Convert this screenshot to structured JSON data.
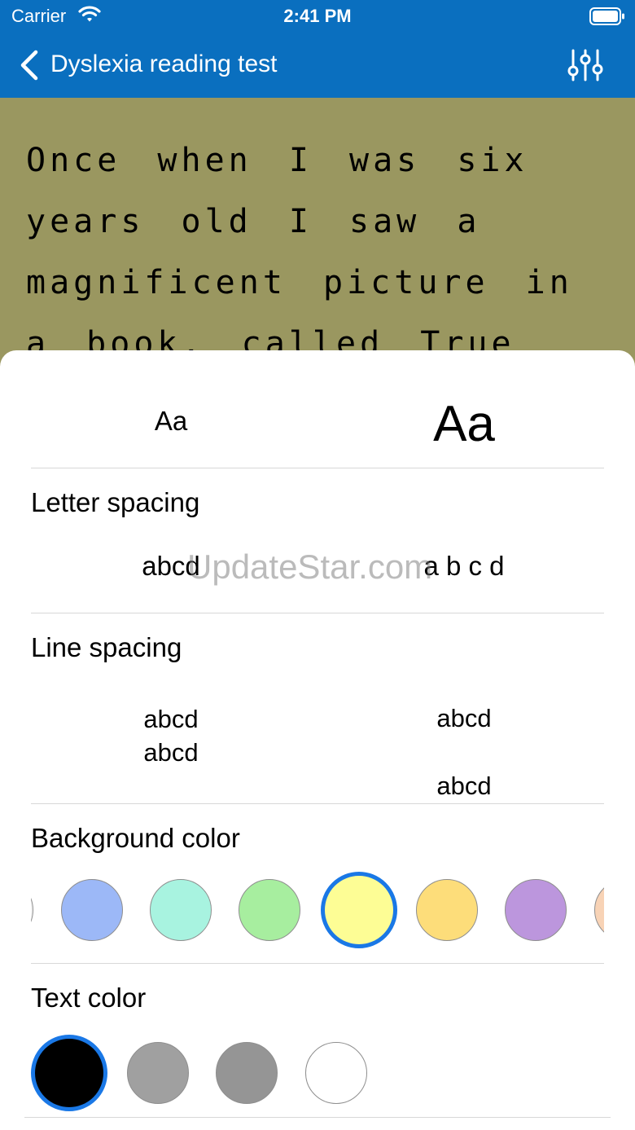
{
  "status_bar": {
    "carrier": "Carrier",
    "time": "2:41 PM"
  },
  "nav": {
    "title": "Dyslexia reading test"
  },
  "reading_text": "Once when I was six years old I saw a magnificent picture in a book, called True Stories from Nature,",
  "font_size": {
    "small_label": "Aa",
    "large_label": "Aa"
  },
  "letter_spacing": {
    "title": "Letter spacing",
    "narrow_label": "abcd",
    "wide_label": "a b c d"
  },
  "line_spacing": {
    "title": "Line spacing",
    "tight_line1": "abcd",
    "tight_line2": "abcd",
    "loose_line1": "abcd",
    "loose_line2": "abcd"
  },
  "background_color": {
    "title": "Background color",
    "swatches": [
      "#f2f2f2",
      "#9cb8f7",
      "#a8f3e0",
      "#a7ee9f",
      "#fdfd95",
      "#fddd7a",
      "#bc96dd",
      "#f8d3b6"
    ],
    "selected_index": 4
  },
  "text_color": {
    "title": "Text color",
    "swatches": [
      "#000000",
      "#a0a0a0",
      "#959595",
      "#ffffff"
    ],
    "selected_index": 0
  },
  "watermark": "UpdateStar.com"
}
